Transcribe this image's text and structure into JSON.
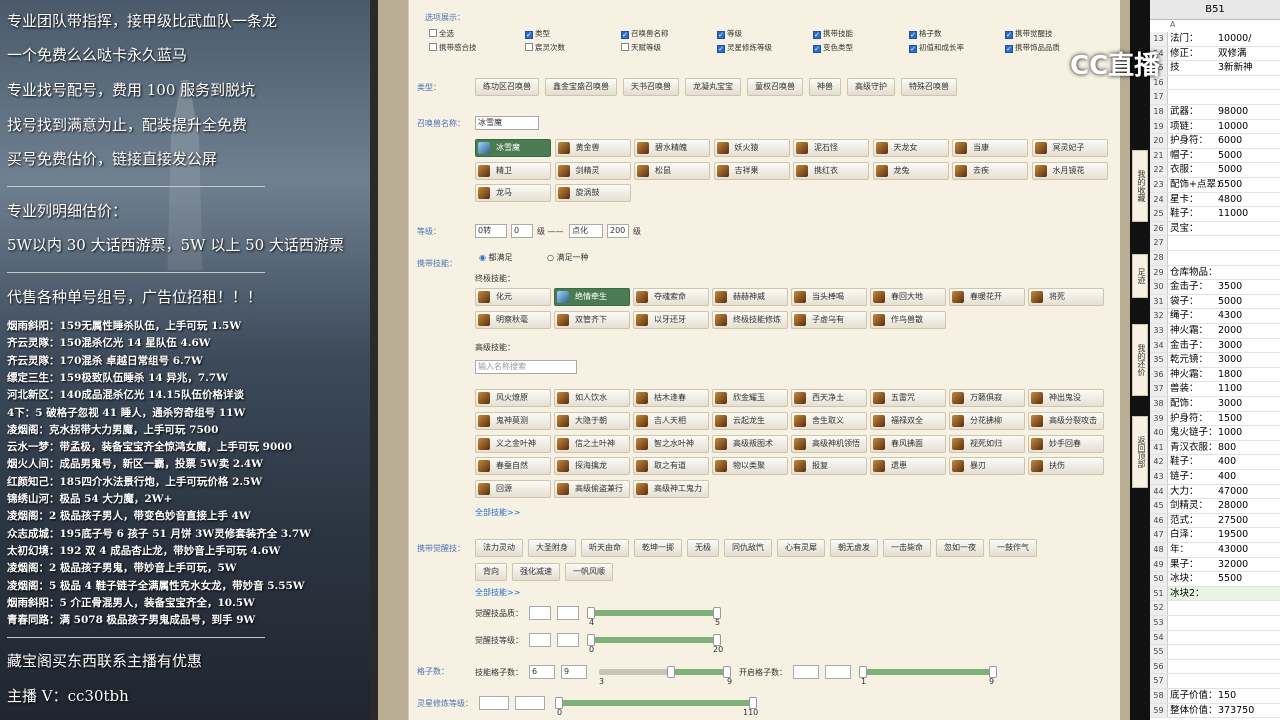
{
  "left": {
    "lines": [
      "专业团队带指挥，接甲级比武血队一条龙",
      "一个免费么么哒卡永久蓝马",
      "专业找号配号，费用 100 服务到脱坑",
      "找号找到满意为止，配装提升全免费",
      "买号免费估价，链接直接发公屏",
      "专业列明细估价：",
      "5W以内 30 大话西游票，5W 以上 50 大话西游票",
      "代售各种单号组号，广告位招租！！！"
    ],
    "ads": [
      "烟雨斜阳：159无属性睡杀队伍，上手可玩 1.5W",
      "齐云灵隊：150混杀亿光 14 星队伍 4.6W",
      "齐云灵隊：170混杀 卓越日常组号 6.7W",
      "缥定三生：159极致队伍睡杀 14 异兆，7.7W",
      "河北新区：140成品混杀亿光 14.15队伍价格详谈",
      "4下：5 破格子忽视 41 睡人，通杀穷奇组号 11W",
      "凌烟阁：克水拐带大力男魔，上手可玩 7500",
      "云水一梦：带孟极，装备宝宝齐全惊鸿女魔，上手可玩 9000",
      "烟火人间：成品男鬼号，新区一霸，投票 5W卖 2.4W",
      "红颜知己：185四介水法景行炮，上手可玩价格 2.5W",
      "锦绣山河：极品 54 大力魔，2W+",
      "凌烟阁：2 极品孩子男人，带变色妙音直接上手 4W",
      "众志成城：195底子号 6 孩子 51 月饼 3W灵修套装齐全 3.7W",
      "太初幻境：192 双 4 成品杏止龙，带妙音上手可玩 4.6W",
      "凌烟阁：2 极品孩子男鬼，带妙音上手可玩，5W",
      "凌烟阁：5 极品 4 鞋子链子全满属性克水女龙，带妙音 5.55W",
      "烟雨斜阳：5 介正骨混男人，装备宝宝齐全，10.5W",
      "青春同路：满 5078 极品孩子男鬼成品号，到手 9W"
    ],
    "footer1": "藏宝阁买东西联系主播有优惠",
    "footer2": "主播 V：cc30tbh"
  },
  "panel": {
    "options_label": "选项展示：",
    "options": [
      {
        "t": "全选",
        "on": false
      },
      {
        "t": "类型",
        "on": true
      },
      {
        "t": "召唤兽名称",
        "on": true
      },
      {
        "t": "等级",
        "on": true
      },
      {
        "t": "携带技能",
        "on": true
      },
      {
        "t": "格子数",
        "on": true
      },
      {
        "t": "携带觉醒技",
        "on": true
      },
      {
        "t": "携带感合技",
        "on": false
      },
      {
        "t": "宸灵次数",
        "on": false
      },
      {
        "t": "天赋等级",
        "on": false
      },
      {
        "t": "灵星修炼等级",
        "on": true
      },
      {
        "t": "变色类型",
        "on": true
      },
      {
        "t": "初值和成长率",
        "on": true
      },
      {
        "t": "携带饰品品质",
        "on": true
      }
    ],
    "type_label": "类型：",
    "types": [
      "练功区召唤兽",
      "鑫金宝盛召唤兽",
      "天书召唤兽",
      "龙凝丸宝宝",
      "童权召唤兽",
      "神兽",
      "高级守护",
      "特殊召唤兽"
    ],
    "name_label": "召唤兽名称：",
    "name_value": "冰雪魔",
    "pets": [
      "冰雪魔",
      "黄金兽",
      "碧水精魄",
      "妖火猿",
      "泥石怪",
      "天龙女",
      "当康",
      "冥灵妃子",
      "精卫",
      "剑精灵",
      "松鼠",
      "吉祥果",
      "携红衣",
      "龙兔",
      "去疾",
      "水月镜花",
      "龙马",
      "旋涡鼓"
    ],
    "level_label": "等级：",
    "level_a": "0转",
    "level_b": "0",
    "level_unit1": "级 ——",
    "level_c": "点化",
    "level_d": "200",
    "level_unit2": "级",
    "skill_label": "携带技能：",
    "radio1": "都满足",
    "radio2": "满足一种",
    "final_label": "终极技能：",
    "final_skills": [
      "化元",
      "绝情牵生",
      "夺魂索命",
      "赫赫神威",
      "当头棒喝",
      "春回大地",
      "春暖花开",
      "将死",
      "明察秋毫",
      "双管齐下",
      "以牙还牙",
      "终极技能修炼",
      "子虚乌有",
      "作鸟兽散"
    ],
    "adv_label": "高级技能：",
    "adv_placeholder": "输入名称搜索",
    "adv_skills": [
      "风火燎原",
      "如人饮水",
      "枯木逢春",
      "欣金耀玉",
      "西天净土",
      "五雷咒",
      "万籁俱寂",
      "神出鬼没",
      "鬼神莫测",
      "大隐于朝",
      "吉人天相",
      "云起龙生",
      "舍生取义",
      "福禄双全",
      "分花拂柳",
      "高级分裂攻击",
      "义之金叶神",
      "信之土叶神",
      "智之水叶神",
      "高级叛图术",
      "高级神机领悟",
      "春风拂面",
      "视死如归",
      "妙手回春",
      "春蚕自然",
      "探海擒龙",
      "取之有道",
      "物以类聚",
      "报复",
      "遗患",
      "暴刃",
      "扶伤",
      "回源",
      "高级偷盗兼行",
      "高级神工鬼力"
    ],
    "all_skills": "全部技能>>",
    "wake_label": "携带觉醒技：",
    "wake": [
      "法力灵动",
      "大圣附身",
      "听天由命",
      "乾坤一掷",
      "无极",
      "同仇敌忾",
      "心有灵犀",
      "朝无虚发",
      "一击毙命",
      "忽如一夜",
      "一鼓作气",
      "背向",
      "强化减速",
      "一帆风顺"
    ],
    "all_wake": "全部技能>>",
    "wq_label": "觉醒技品质：",
    "wq_min": "4",
    "wq_max": "5",
    "wl_label": "觉醒技等级：",
    "wl_min": "0",
    "wl_max": "20",
    "grid_label": "格子数：",
    "gs_label": "技能格子数：",
    "gs_a": "6",
    "gs_b": "9",
    "gs_min": "3",
    "gs_max": "9",
    "open_label": "开启格子数：",
    "og_min": "1",
    "og_max": "9",
    "spirit_label": "灵星修炼等级：",
    "sp_min": "0",
    "sp_max": "110"
  },
  "sidetabs": [
    "我的收藏",
    "足迹",
    "我的还价",
    "返回顶部"
  ],
  "sheet": {
    "cell": "B51",
    "col": "A",
    "rows": [
      [
        "13",
        "法门：",
        "10000/"
      ],
      [
        "14",
        "修正：",
        "双修满"
      ],
      [
        "15",
        "技",
        "3新新神"
      ],
      [
        "16",
        "",
        ""
      ],
      [
        "17",
        "",
        ""
      ],
      [
        "18",
        "武器：",
        "98000"
      ],
      [
        "19",
        "项链：",
        "10000"
      ],
      [
        "20",
        "护身符：",
        "6000"
      ],
      [
        "21",
        "帽子：",
        "5000"
      ],
      [
        "22",
        "衣服：",
        "5000"
      ],
      [
        "23",
        "配饰+点翠：",
        "6500"
      ],
      [
        "24",
        "星卡：",
        "4800"
      ],
      [
        "25",
        "鞋子：",
        "11000"
      ],
      [
        "26",
        "灵宝：",
        ""
      ],
      [
        "27",
        "",
        ""
      ],
      [
        "28",
        "",
        ""
      ],
      [
        "29",
        "仓库物品：",
        ""
      ],
      [
        "30",
        "金击子：",
        "3500"
      ],
      [
        "31",
        "袋子：",
        "5000"
      ],
      [
        "32",
        "绳子：",
        "4300"
      ],
      [
        "33",
        "神火霜：",
        "2000"
      ],
      [
        "34",
        "金击子：",
        "3000"
      ],
      [
        "35",
        "乾元镜：",
        "3000"
      ],
      [
        "36",
        "神火霜：",
        "1800"
      ],
      [
        "37",
        "兽装：",
        "1100"
      ],
      [
        "38",
        "配饰：",
        "3000"
      ],
      [
        "39",
        "护身符：",
        "1500"
      ],
      [
        "40",
        "鬼火链子：",
        "1000"
      ],
      [
        "41",
        "青汉衣服：",
        "800"
      ],
      [
        "42",
        "鞋子：",
        "400"
      ],
      [
        "43",
        "链子：",
        "400"
      ],
      [
        "44",
        "大力：",
        "47000"
      ],
      [
        "45",
        "剑精灵：",
        "28000"
      ],
      [
        "46",
        "范式：",
        "27500"
      ],
      [
        "47",
        "白泽：",
        "19500"
      ],
      [
        "48",
        "年：",
        "43000"
      ],
      [
        "49",
        "果子：",
        "32000"
      ],
      [
        "50",
        "冰块：",
        "5500"
      ],
      [
        "51",
        "冰块2：",
        ""
      ],
      [
        "52",
        "",
        ""
      ],
      [
        "53",
        "",
        ""
      ],
      [
        "54",
        "",
        ""
      ],
      [
        "55",
        "",
        ""
      ],
      [
        "56",
        "",
        ""
      ],
      [
        "57",
        "",
        ""
      ],
      [
        "58",
        "底子价值：",
        "150"
      ],
      [
        "59",
        "整体价值：",
        "373750"
      ]
    ]
  },
  "logo": "CC直播"
}
